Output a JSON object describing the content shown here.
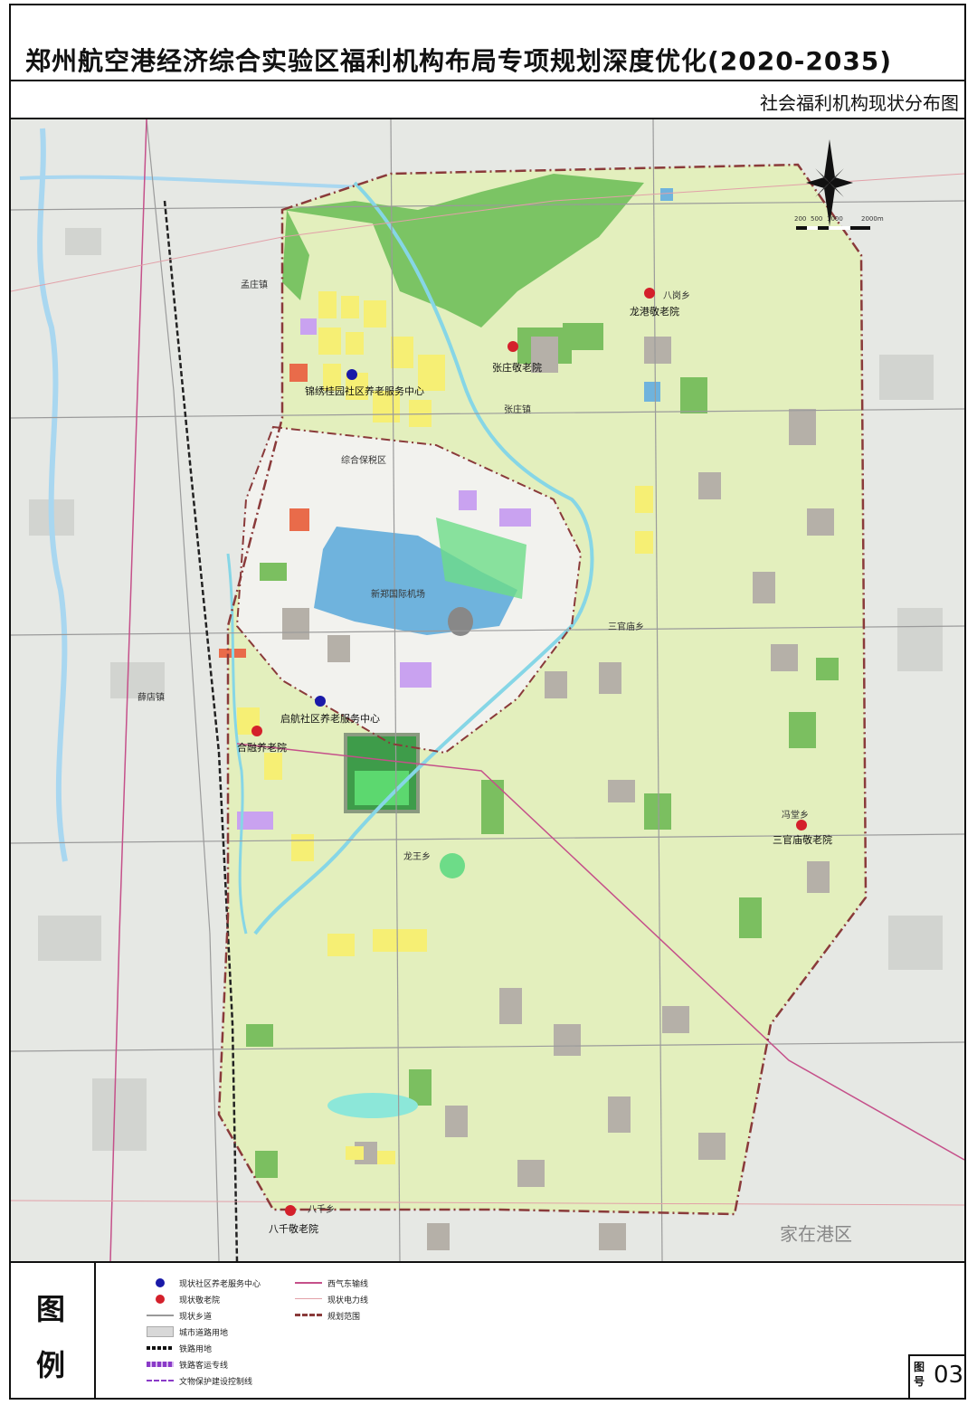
{
  "title": "郑州航空港经济综合实验区福利机构布局专项规划深度优化(2020-2035)",
  "subtitle": "社会福利机构现状分布图",
  "watermark": "家在港区",
  "facilities": [
    {
      "name": "锦绣桂园社区养老服务中心",
      "type": "community",
      "color": "#1a1aa8"
    },
    {
      "name": "启航社区养老服务中心",
      "type": "community",
      "color": "#1a1aa8"
    },
    {
      "name": "张庄敬老院",
      "type": "nursing",
      "color": "#d4202b"
    },
    {
      "name": "龙港敬老院",
      "type": "nursing",
      "color": "#d4202b"
    },
    {
      "name": "合融养老院",
      "type": "nursing",
      "color": "#d4202b"
    },
    {
      "name": "三官庙敬老院",
      "type": "nursing",
      "color": "#d4202b"
    },
    {
      "name": "八千敬老院",
      "type": "nursing",
      "color": "#d4202b"
    }
  ],
  "places": [
    "孟庄镇",
    "张庄镇",
    "八岗乡",
    "综合保税区",
    "新郑国际机场",
    "三官庙乡",
    "薛店镇",
    "龙王乡",
    "冯堂乡",
    "八千乡"
  ],
  "scale_bar": {
    "labels": [
      "200",
      "500",
      "1000",
      "2000m"
    ]
  },
  "legend": {
    "title_chars": [
      "图",
      "例"
    ],
    "items": [
      {
        "label": "现状社区养老服务中心",
        "symbol": "blue-dot"
      },
      {
        "label": "现状敬老院",
        "symbol": "red-dot"
      },
      {
        "label": "现状乡道",
        "symbol": "grey-line"
      },
      {
        "label": "城市道路用地",
        "symbol": "grey-fill"
      },
      {
        "label": "铁路用地",
        "symbol": "rail"
      },
      {
        "label": "铁路客运专线",
        "symbol": "rail-purple"
      },
      {
        "label": "文物保护建设控制线",
        "symbol": "purple-dash"
      },
      {
        "label": "西气东输线",
        "symbol": "magenta-line"
      },
      {
        "label": "现状电力线",
        "symbol": "pink-line"
      },
      {
        "label": "规划范围",
        "symbol": "boundary"
      }
    ]
  },
  "figure": {
    "label": "图号",
    "number": "03"
  },
  "colors": {
    "community": "#1a1aa8",
    "nursing": "#d4202b",
    "green": "#6ebf5a",
    "yellow": "#f4ee6e",
    "blue": "#6fb3dd",
    "boundary": "#8a3a3a"
  }
}
